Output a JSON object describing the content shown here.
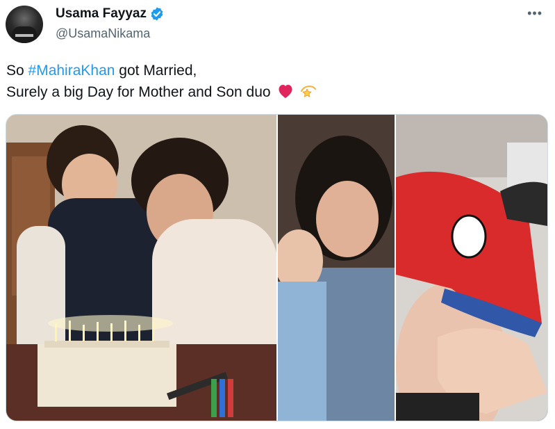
{
  "author": {
    "display_name": "Usama Fayyaz",
    "handle": "@UsamaNikama",
    "verified": true
  },
  "menu": {
    "more_label": "•••"
  },
  "tweet": {
    "text_prefix": "So ",
    "hashtag": "#MahiraKhan",
    "text_after_hashtag": " got Married,",
    "line2": "Surely a big Day for Mother and Son duo",
    "emojis": [
      "red-heart",
      "dizzy-star"
    ]
  },
  "media": {
    "images": [
      {
        "description_name": "birthday-cake-photo"
      },
      {
        "description_name": "collage-photo"
      }
    ]
  },
  "colors": {
    "hashtag": "#1d9bf0",
    "verified_badge": "#1d9bf0",
    "secondary_text": "#536471",
    "heart": "#e0245e"
  }
}
